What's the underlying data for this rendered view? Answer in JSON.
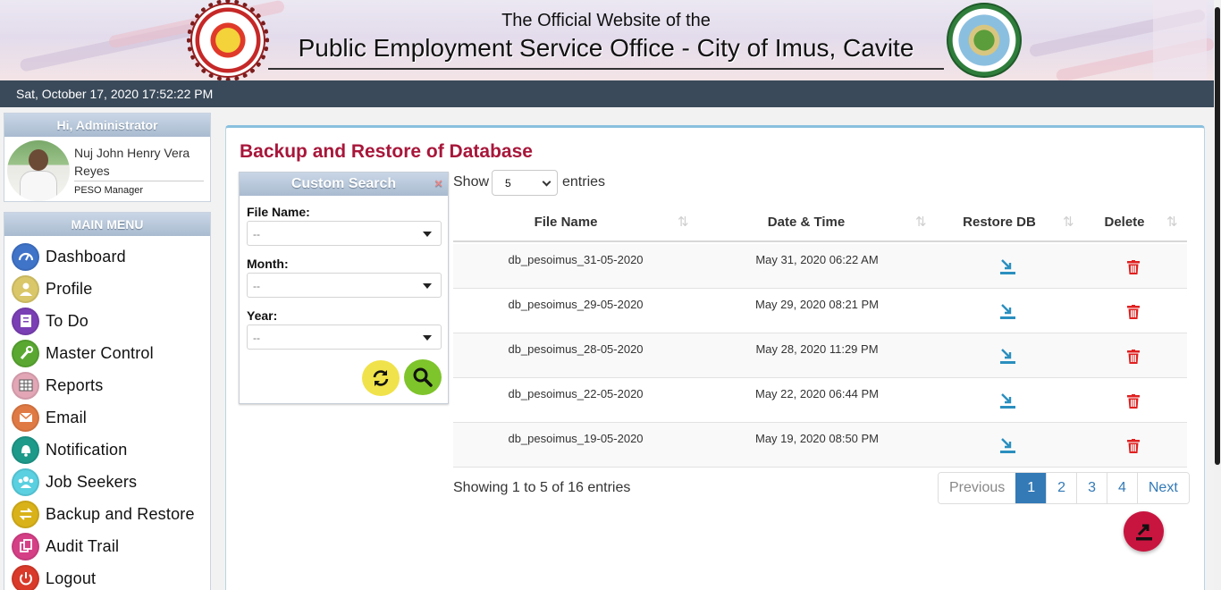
{
  "header": {
    "top_line": "The Official Website of the",
    "main_line": "Public Employment Service Office - City of Imus, Cavite",
    "peso_logo_text": "PUBLIC EMPLOYMENT SERVICE OFFICE P.E.S.O.",
    "imus_logo_text": "LUNGSOD NG IMUS LALAWIGAN NG CAVITE 2012"
  },
  "datetime": "Sat, October 17, 2020 17:52:22 PM",
  "user_panel": {
    "greeting": "Hi, Administrator",
    "name": "Nuj John Henry Vera Reyes",
    "role": "PESO Manager"
  },
  "menu": {
    "title": "MAIN MENU",
    "items": [
      {
        "label": "Dashboard",
        "icon": "dashboard-icon",
        "color": "#3f74c9"
      },
      {
        "label": "Profile",
        "icon": "profile-icon",
        "color": "#d9c769"
      },
      {
        "label": "To Do",
        "icon": "todo-icon",
        "color": "#7b3fb5"
      },
      {
        "label": "Master Control",
        "icon": "wrench-icon",
        "color": "#5aa832"
      },
      {
        "label": "Reports",
        "icon": "reports-icon",
        "color": "#e2a6b7"
      },
      {
        "label": "Email",
        "icon": "email-icon",
        "color": "#e07a44"
      },
      {
        "label": "Notification",
        "icon": "bell-icon",
        "color": "#1e9a8a"
      },
      {
        "label": "Job Seekers",
        "icon": "users-icon",
        "color": "#5ad0e0"
      },
      {
        "label": "Backup and Restore",
        "icon": "swap-icon",
        "color": "#d9b21a"
      },
      {
        "label": "Audit Trail",
        "icon": "audit-icon",
        "color": "#d53f86"
      },
      {
        "label": "Logout",
        "icon": "power-icon",
        "color": "#d93a2a"
      }
    ]
  },
  "page_title": "Backup and Restore of Database",
  "custom_search": {
    "title": "Custom Search",
    "close": "×",
    "fields": [
      {
        "label": "File Name:",
        "value": "--"
      },
      {
        "label": "Month:",
        "value": "--"
      },
      {
        "label": "Year:",
        "value": "--"
      }
    ]
  },
  "table_length": {
    "show": "Show",
    "value": "5",
    "entries": "entries"
  },
  "table": {
    "headers": [
      "File Name",
      "Date & Time",
      "Restore DB",
      "Delete"
    ],
    "rows": [
      {
        "file": "db_pesoimus_31-05-2020",
        "date": "May 31, 2020 06:22 AM"
      },
      {
        "file": "db_pesoimus_29-05-2020",
        "date": "May 29, 2020 08:21 PM"
      },
      {
        "file": "db_pesoimus_28-05-2020",
        "date": "May 28, 2020 11:29 PM"
      },
      {
        "file": "db_pesoimus_22-05-2020",
        "date": "May 22, 2020 06:44 PM"
      },
      {
        "file": "db_pesoimus_19-05-2020",
        "date": "May 19, 2020 08:50 PM"
      }
    ]
  },
  "info": "Showing 1 to 5 of 16 entries",
  "pagination": {
    "previous": "Previous",
    "pages": [
      "1",
      "2",
      "3",
      "4"
    ],
    "active": "1",
    "next": "Next"
  },
  "colors": {
    "title": "#a8163a",
    "datebar": "#3a4a5a",
    "accent_blue": "#337ab7",
    "restore_icon": "#2a8fbf",
    "delete_icon": "#e02020",
    "fab": "#c8153f"
  }
}
